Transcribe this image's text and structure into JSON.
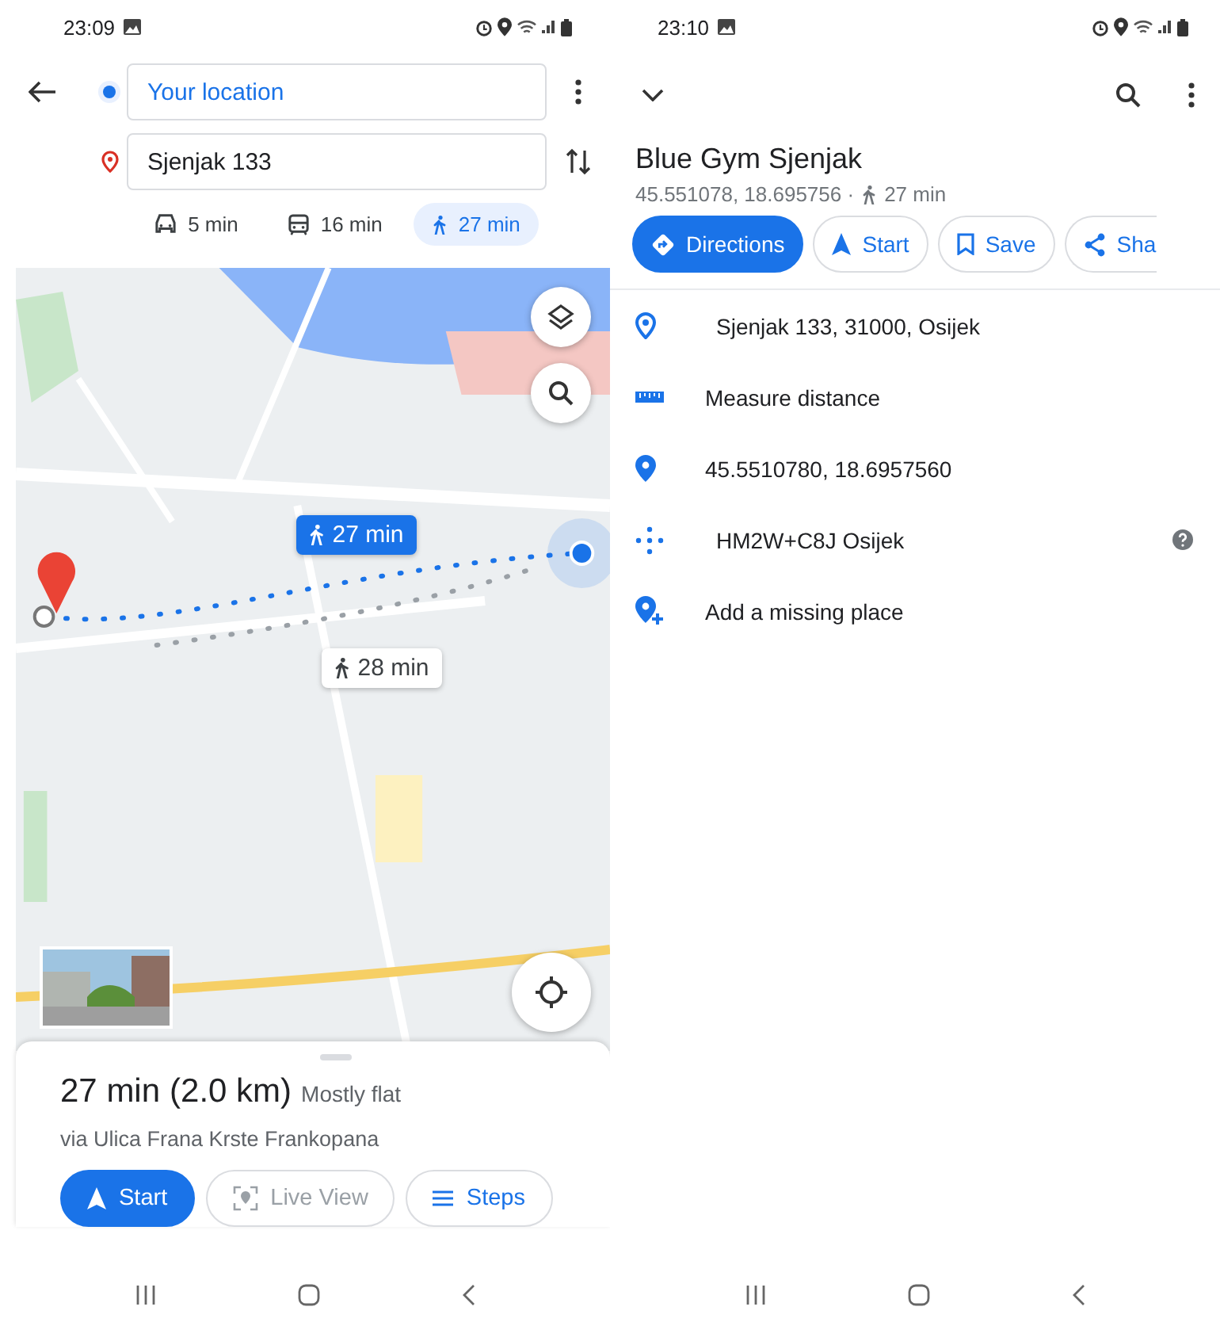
{
  "left": {
    "status_bar": {
      "time": "23:09"
    },
    "from": {
      "value": "Your location"
    },
    "to": {
      "value": "Sjenjak 133"
    },
    "modes": [
      {
        "kind": "car",
        "label": "5 min",
        "selected": false
      },
      {
        "kind": "transit",
        "label": "16 min",
        "selected": false
      },
      {
        "kind": "walk",
        "label": "27 min",
        "selected": true
      }
    ],
    "map": {
      "kind": "picture",
      "routes": [
        {
          "label": "27 min",
          "selected": true
        },
        {
          "label": "28 min",
          "selected": false
        }
      ]
    },
    "sheet": {
      "duration": "27 min",
      "distance": "(2.0 km)",
      "terrain": "Mostly flat",
      "via": "via Ulica Frana Krste Frankopana",
      "buttons": [
        {
          "kind": "start",
          "label": "Start",
          "disabled": false
        },
        {
          "kind": "live",
          "label": "Live View",
          "disabled": true
        },
        {
          "kind": "steps",
          "label": "Steps",
          "disabled": false
        }
      ]
    }
  },
  "right": {
    "status_bar": {
      "time": "23:10"
    },
    "place": {
      "name": "Blue Gym Sjenjak",
      "coords": "45.551078, 18.695756 ·",
      "walk_time": "27 min"
    },
    "actions": [
      {
        "kind": "directions",
        "label": "Directions"
      },
      {
        "kind": "start",
        "label": "Start"
      },
      {
        "kind": "save",
        "label": "Save"
      },
      {
        "kind": "share",
        "label": "Sha"
      }
    ],
    "details": [
      {
        "kind": "address",
        "text": "Sjenjak 133, 31000, Osijek",
        "help": false
      },
      {
        "kind": "measure",
        "text": "Measure distance",
        "help": false
      },
      {
        "kind": "coords",
        "text": "45.5510780, 18.6957560",
        "help": false
      },
      {
        "kind": "pluscode",
        "text": "HM2W+C8J Osijek",
        "help": true
      },
      {
        "kind": "add",
        "text": "Add a missing place",
        "help": false
      }
    ]
  }
}
